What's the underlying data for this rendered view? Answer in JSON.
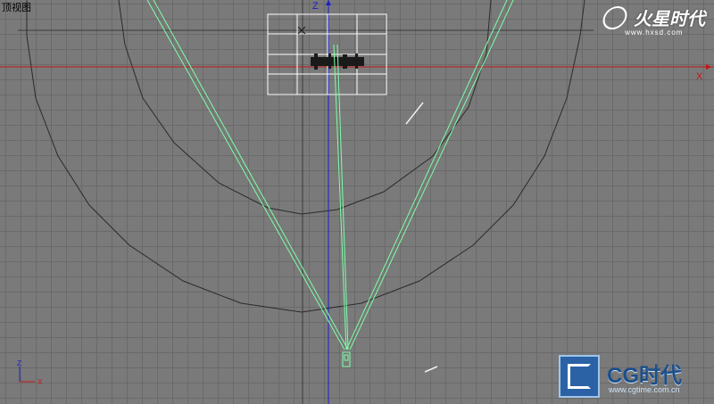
{
  "viewport": {
    "label": "顶视图",
    "axis_labels": {
      "vertical": "Z",
      "horizontal": "X"
    },
    "gizmo_labels": {
      "up": "Z",
      "right": "X"
    }
  },
  "colors": {
    "background": "#7a7a7a",
    "grid": "#6a6a6a",
    "axis_vertical": "#1b1fc8",
    "axis_horizontal": "#c21818",
    "camera": "#7dffa8",
    "objects": "#2b2b2b",
    "selection": "#ffffff"
  },
  "watermarks": {
    "top_right": {
      "name": "火星时代",
      "url": "www.hxsd.com"
    },
    "bottom_right": {
      "name": "CG时代",
      "url": "www.cgtime.com.cn"
    }
  }
}
